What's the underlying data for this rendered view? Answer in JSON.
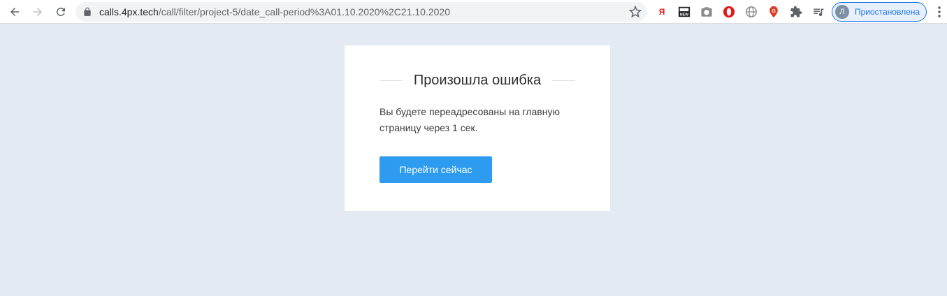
{
  "browser": {
    "url_host": "calls.4px.tech",
    "url_path": "/call/filter/project-5/date_call-period%3A01.10.2020%2C21.10.2020",
    "profile_initial": "Л",
    "profile_label": "Приостановлена",
    "extensions": [
      {
        "icon": "yandex-icon",
        "glyph": "Я",
        "color": "#e02020"
      },
      {
        "icon": "news-icon",
        "glyph": "NEW",
        "color": "#202124"
      },
      {
        "icon": "camera-icon",
        "glyph": "",
        "color": "#5f6368"
      },
      {
        "icon": "opera-icon",
        "glyph": "",
        "color": "#e01b1b"
      },
      {
        "icon": "globe-icon",
        "glyph": "",
        "color": "#8a8a8a"
      },
      {
        "icon": "location-pin-icon",
        "glyph": "",
        "color": "#e03b24"
      },
      {
        "icon": "puzzle-icon",
        "glyph": "",
        "color": "#5f6368"
      },
      {
        "icon": "media-queue-icon",
        "glyph": "",
        "color": "#5f6368"
      }
    ]
  },
  "card": {
    "title": "Произошла ошибка",
    "message": "Вы будете переадресованы на главную страницу через 1 сек.",
    "button_label": "Перейти сейчас"
  },
  "colors": {
    "page_background": "#e3eaf2",
    "button": "#2d9cf0",
    "profile_accent": "#1a73e8"
  }
}
